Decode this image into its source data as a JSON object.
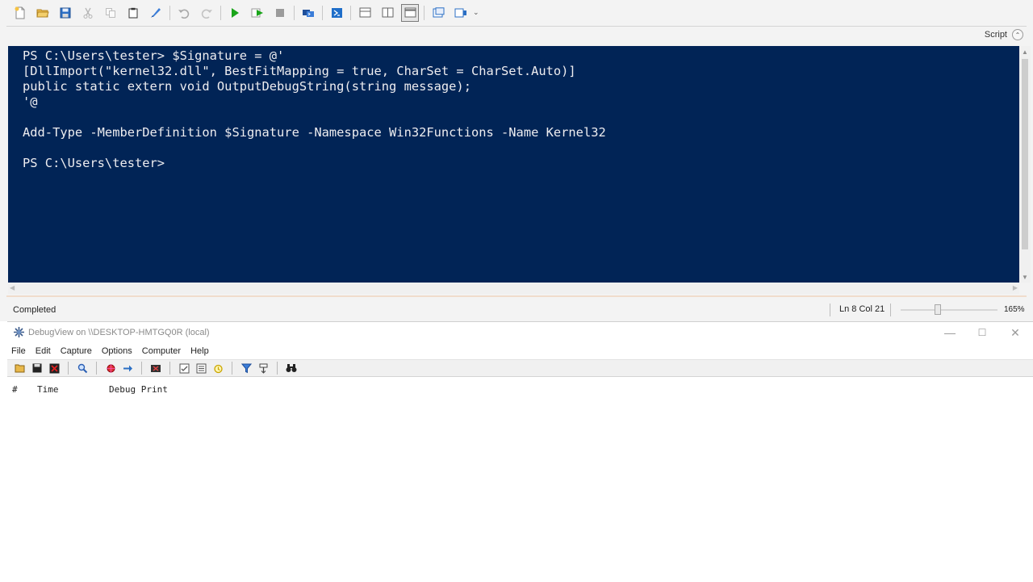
{
  "ise": {
    "toolbar": {
      "icons": [
        "new-file-icon",
        "open-folder-icon",
        "save-icon",
        "cut-icon",
        "copy-icon",
        "paste-icon",
        "clear-console-icon",
        "undo-icon",
        "redo-icon",
        "run-script-icon",
        "run-selection-icon",
        "stop-icon",
        "remote-powershell-icon",
        "start-powershell-icon",
        "show-script-top-icon",
        "show-script-right-icon",
        "show-script-maximized-icon",
        "show-command-window-icon",
        "show-command-addon-icon"
      ],
      "overflow": "⌄"
    },
    "script_toggle_label": "Script",
    "console_lines": [
      "PS C:\\Users\\tester> $Signature = @'",
      "[DllImport(\"kernel32.dll\", BestFitMapping = true, CharSet = CharSet.Auto)]",
      "public static extern void OutputDebugString(string message);",
      "'@",
      "",
      "Add-Type -MemberDefinition $Signature -Namespace Win32Functions -Name Kernel32",
      "",
      "PS C:\\Users\\tester>"
    ],
    "status": {
      "text": "Completed",
      "position": "Ln 8  Col 21",
      "zoom": "165%",
      "zoom_slider_fraction": 0.38
    }
  },
  "debugview": {
    "title": "DebugView on \\\\DESKTOP-HMTGQ0R (local)",
    "window_controls": {
      "minimize": "—",
      "maximize": "☐",
      "close": "✕"
    },
    "menu": [
      "File",
      "Edit",
      "Capture",
      "Options",
      "Computer",
      "Help"
    ],
    "columns": [
      "#",
      "Time",
      "Debug Print"
    ],
    "rows": []
  },
  "colors": {
    "console_bg": "#012456",
    "console_fg": "#eeedf0",
    "ise_chrome": "#f3f3f3"
  }
}
